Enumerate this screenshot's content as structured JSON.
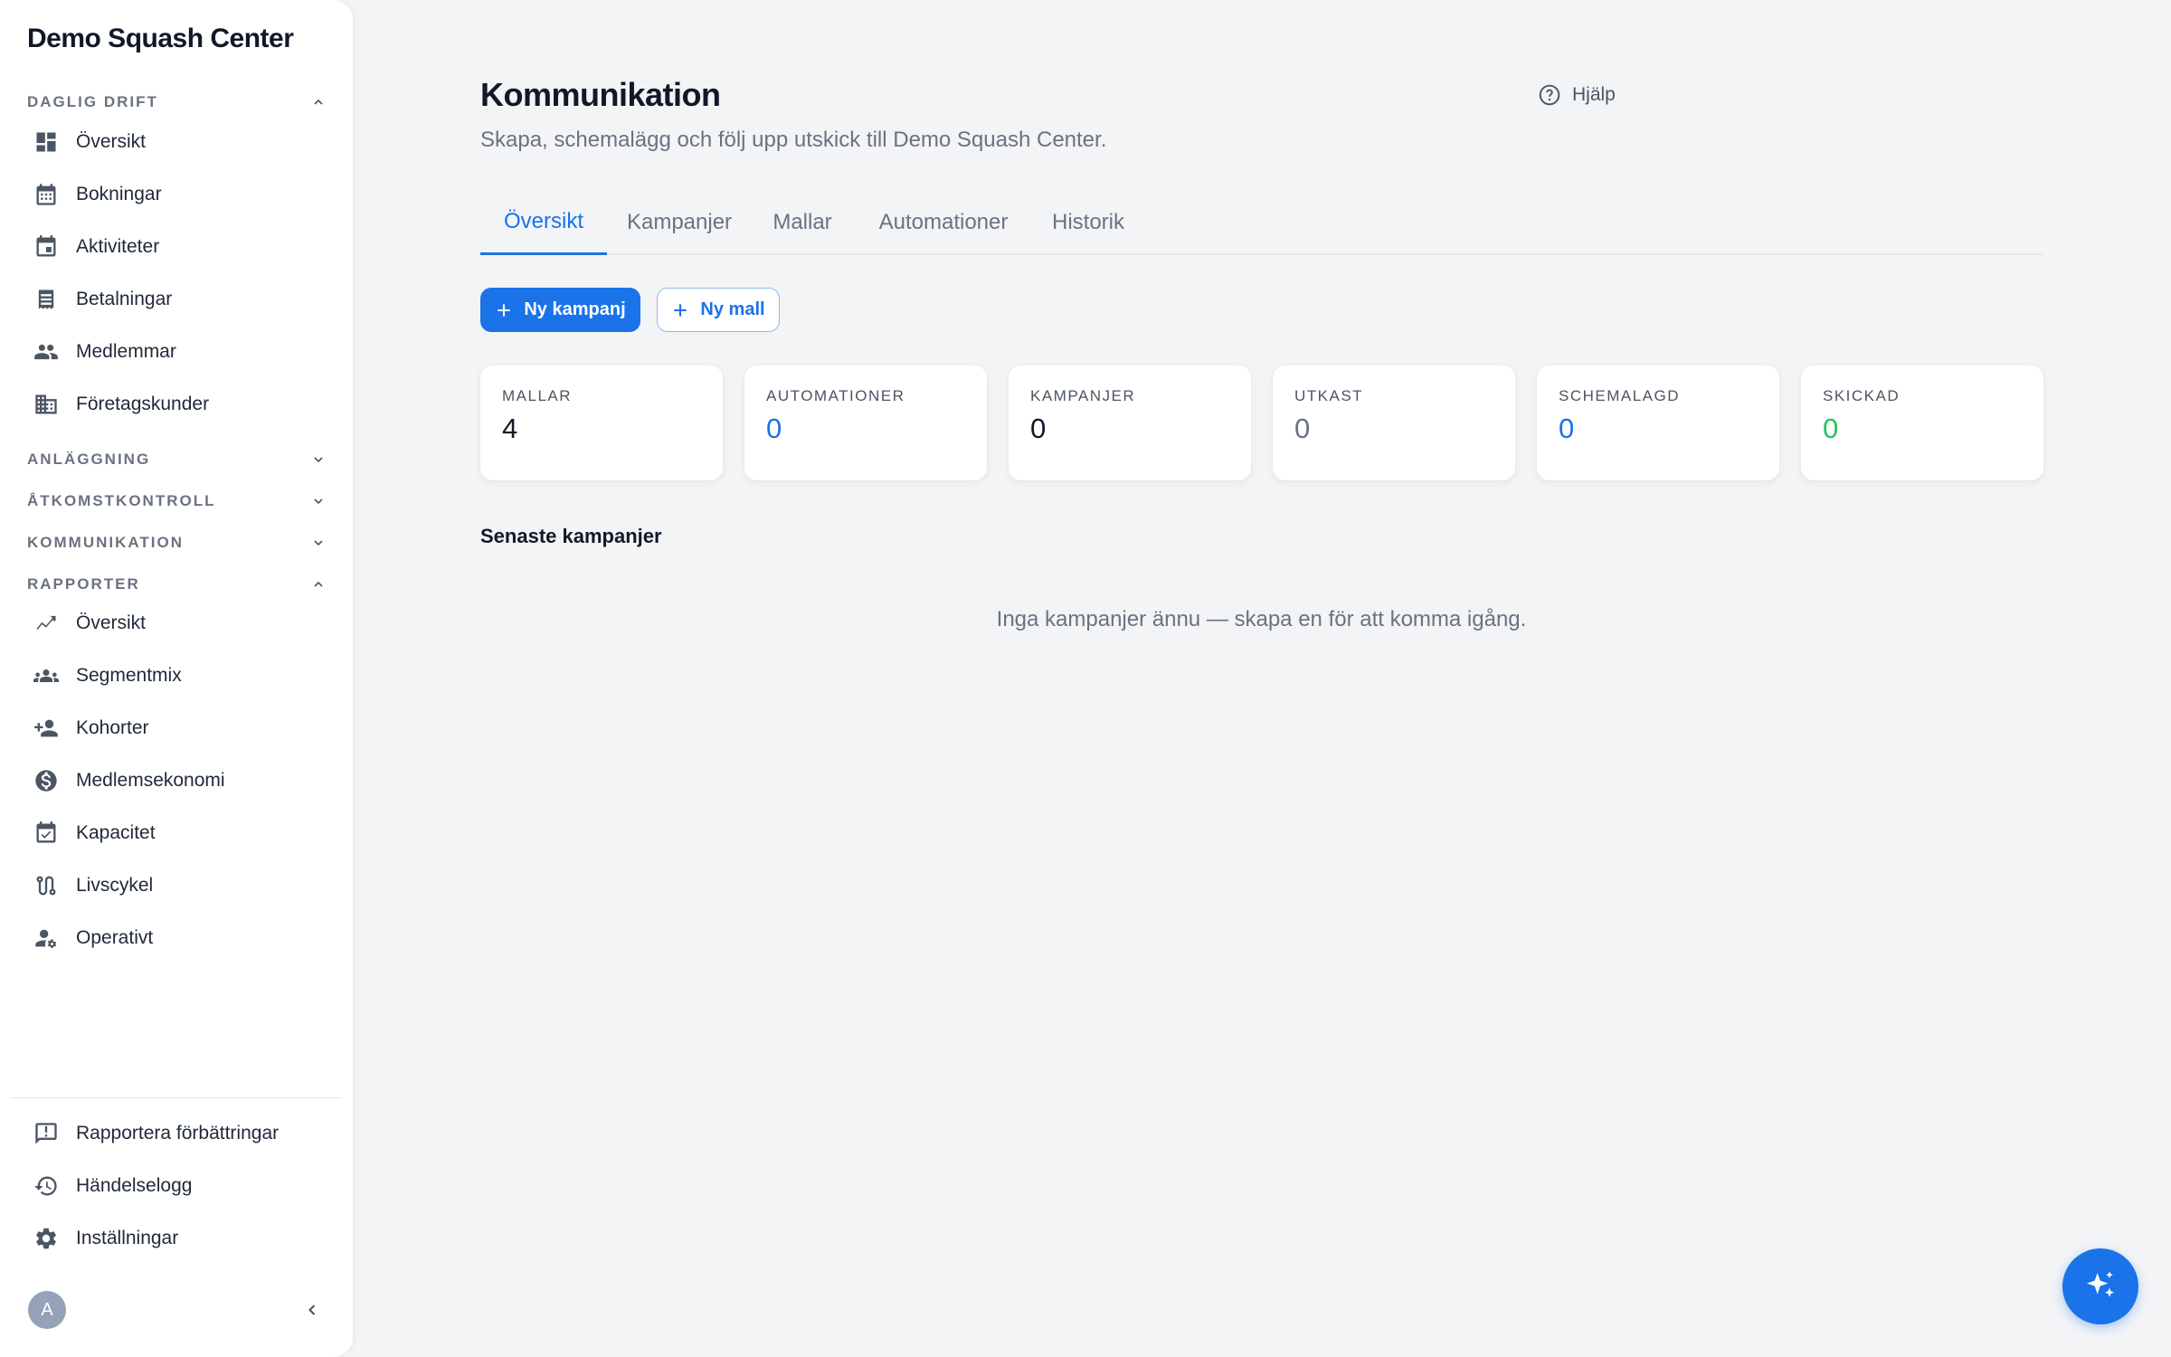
{
  "sidebar": {
    "brand": "Demo Squash Center",
    "sections": [
      {
        "title": "DAGLIG DRIFT",
        "expanded": true,
        "items": [
          {
            "label": "Översikt",
            "icon": "dashboard-icon"
          },
          {
            "label": "Bokningar",
            "icon": "calendar-grid-icon"
          },
          {
            "label": "Aktiviteter",
            "icon": "calendar-event-icon"
          },
          {
            "label": "Betalningar",
            "icon": "receipt-icon"
          },
          {
            "label": "Medlemmar",
            "icon": "people-icon"
          },
          {
            "label": "Företagskunder",
            "icon": "building-icon"
          }
        ]
      },
      {
        "title": "ANLÄGGNING",
        "expanded": false
      },
      {
        "title": "ÅTKOMSTKONTROLL",
        "expanded": false
      },
      {
        "title": "KOMMUNIKATION",
        "expanded": false
      },
      {
        "title": "RAPPORTER",
        "expanded": true,
        "items": [
          {
            "label": "Översikt",
            "icon": "trend-icon"
          },
          {
            "label": "Segmentmix",
            "icon": "groups-icon"
          },
          {
            "label": "Kohorter",
            "icon": "person-add-icon"
          },
          {
            "label": "Medlemsekonomi",
            "icon": "dollar-circle-icon"
          },
          {
            "label": "Kapacitet",
            "icon": "event-available-icon"
          },
          {
            "label": "Livscykel",
            "icon": "route-icon"
          },
          {
            "label": "Operativt",
            "icon": "manage-accounts-icon"
          }
        ]
      }
    ],
    "footer": [
      {
        "label": "Rapportera förbättringar",
        "icon": "feedback-icon"
      },
      {
        "label": "Händelselogg",
        "icon": "history-icon"
      },
      {
        "label": "Inställningar",
        "icon": "gear-icon"
      }
    ],
    "avatar_initial": "A"
  },
  "header": {
    "title": "Kommunikation",
    "subtitle": "Skapa, schemalägg och följ upp utskick till Demo Squash Center.",
    "help_label": "Hjälp"
  },
  "tabs": [
    {
      "label": "Översikt",
      "active": true
    },
    {
      "label": "Kampanjer",
      "active": false
    },
    {
      "label": "Mallar",
      "active": false
    },
    {
      "label": "Automationer",
      "active": false
    },
    {
      "label": "Historik",
      "active": false
    }
  ],
  "actions": {
    "new_campaign": "Ny kampanj",
    "new_template": "Ny mall"
  },
  "stats": [
    {
      "label": "MALLAR",
      "value": "4",
      "color": "#111827"
    },
    {
      "label": "AUTOMATIONER",
      "value": "0",
      "color": "#1a73e8"
    },
    {
      "label": "KAMPANJER",
      "value": "0",
      "color": "#111827"
    },
    {
      "label": "UTKAST",
      "value": "0",
      "color": "#6b7280"
    },
    {
      "label": "SCHEMALAGD",
      "value": "0",
      "color": "#1a73e8"
    },
    {
      "label": "SKICKAD",
      "value": "0",
      "color": "#22c55e"
    }
  ],
  "recent": {
    "title": "Senaste kampanjer",
    "empty_text": "Inga kampanjer ännu — skapa en för att komma igång."
  },
  "colors": {
    "accent": "#1a73e8",
    "success": "#22c55e",
    "muted": "#6b7280"
  }
}
